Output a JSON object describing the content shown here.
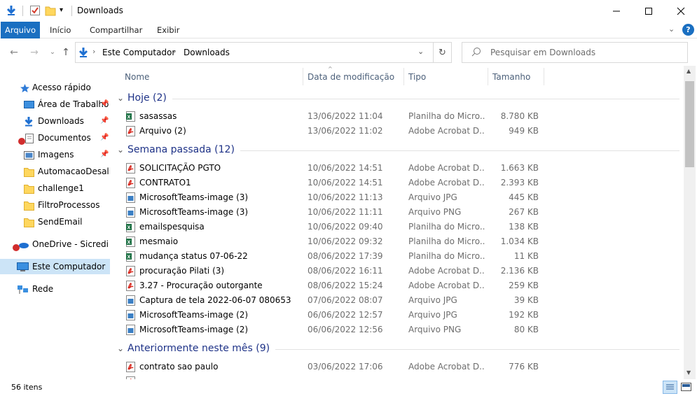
{
  "window": {
    "title": "Downloads"
  },
  "ribbon": {
    "tabs": [
      "Arquivo",
      "Início",
      "Compartilhar",
      "Exibir"
    ]
  },
  "address": {
    "path": [
      "Este Computador",
      "Downloads"
    ]
  },
  "search": {
    "placeholder": "Pesquisar em Downloads"
  },
  "nav": {
    "items": [
      {
        "label": "Acesso rápido",
        "icon": "star-icon"
      },
      {
        "label": "Área de Trabalho",
        "icon": "desktop-icon",
        "pinned": true
      },
      {
        "label": "Downloads",
        "icon": "download-arrow-icon",
        "pinned": true
      },
      {
        "label": "Documentos",
        "icon": "documents-icon",
        "pinned": true
      },
      {
        "label": "Imagens",
        "icon": "pictures-icon",
        "pinned": true
      },
      {
        "label": "AutomacaoDesalier",
        "icon": "folder-icon"
      },
      {
        "label": "challenge1",
        "icon": "folder-icon"
      },
      {
        "label": "FiltroProcessos",
        "icon": "folder-icon"
      },
      {
        "label": "SendEmail",
        "icon": "folder-icon"
      },
      {
        "label": "OneDrive - Sicredi",
        "icon": "onedrive-icon"
      },
      {
        "label": "Este Computador",
        "icon": "computer-icon",
        "selected": true
      },
      {
        "label": "Rede",
        "icon": "network-icon"
      }
    ]
  },
  "columns": [
    "Nome",
    "Data de modificação",
    "Tipo",
    "Tamanho"
  ],
  "groups": [
    {
      "label": "Hoje (2)",
      "files": [
        {
          "name": "sasassas",
          "date": "13/06/2022 11:04",
          "type": "Planilha do Micro...",
          "size": "8.780 KB",
          "icon": "excel"
        },
        {
          "name": "Arquivo (2)",
          "date": "13/06/2022 11:02",
          "type": "Adobe Acrobat D...",
          "size": "949 KB",
          "icon": "pdf"
        }
      ]
    },
    {
      "label": "Semana passada (12)",
      "files": [
        {
          "name": "SOLICITAÇÃO PGTO",
          "date": "10/06/2022 14:51",
          "type": "Adobe Acrobat D...",
          "size": "1.663 KB",
          "icon": "pdf"
        },
        {
          "name": "CONTRATO1",
          "date": "10/06/2022 14:51",
          "type": "Adobe Acrobat D...",
          "size": "2.393 KB",
          "icon": "pdf"
        },
        {
          "name": "MicrosoftTeams-image (3)",
          "date": "10/06/2022 11:13",
          "type": "Arquivo JPG",
          "size": "445 KB",
          "icon": "image"
        },
        {
          "name": "MicrosoftTeams-image (3)",
          "date": "10/06/2022 11:11",
          "type": "Arquivo PNG",
          "size": "267 KB",
          "icon": "image"
        },
        {
          "name": "emailspesquisa",
          "date": "10/06/2022 09:40",
          "type": "Planilha do Micro...",
          "size": "138 KB",
          "icon": "excel"
        },
        {
          "name": "mesmaio",
          "date": "10/06/2022 09:32",
          "type": "Planilha do Micro...",
          "size": "1.034 KB",
          "icon": "excel"
        },
        {
          "name": "mudança status 07-06-22",
          "date": "08/06/2022 17:39",
          "type": "Planilha do Micro...",
          "size": "11 KB",
          "icon": "excel"
        },
        {
          "name": "procuração Pilati (3)",
          "date": "08/06/2022 16:11",
          "type": "Adobe Acrobat D...",
          "size": "2.136 KB",
          "icon": "pdf"
        },
        {
          "name": "3.27 - Procuração outorgante",
          "date": "08/06/2022 15:24",
          "type": "Adobe Acrobat D...",
          "size": "259 KB",
          "icon": "pdf"
        },
        {
          "name": "Captura de tela 2022-06-07 080653",
          "date": "07/06/2022 08:07",
          "type": "Arquivo JPG",
          "size": "39 KB",
          "icon": "image"
        },
        {
          "name": "MicrosoftTeams-image (2)",
          "date": "06/06/2022 12:57",
          "type": "Arquivo JPG",
          "size": "192 KB",
          "icon": "image"
        },
        {
          "name": "MicrosoftTeams-image (2)",
          "date": "06/06/2022 12:56",
          "type": "Arquivo PNG",
          "size": "80 KB",
          "icon": "image"
        }
      ]
    },
    {
      "label": "Anteriormente neste mês (9)",
      "files": [
        {
          "name": "contrato sao paulo",
          "date": "03/06/2022 17:06",
          "type": "Adobe Acrobat D...",
          "size": "776 KB",
          "icon": "pdf"
        },
        {
          "name": "",
          "date": "",
          "type": "",
          "size": "",
          "icon": "pdf"
        }
      ]
    }
  ],
  "status": {
    "count": "56 itens"
  },
  "colors": {
    "accent": "#1a6fc1",
    "group_header": "#1e3287",
    "selected": "#cce4f7"
  }
}
